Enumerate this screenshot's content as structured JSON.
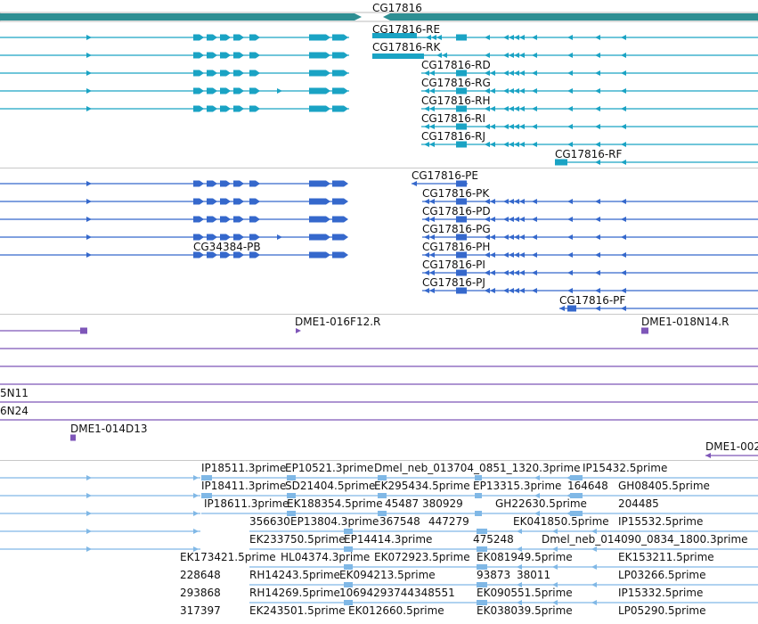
{
  "gene": {
    "name": "CG17816",
    "color": "#2e8f93"
  },
  "colors": {
    "transcript": "#1aa3c4",
    "protein": "#3568cc",
    "clone": "#7e56b8",
    "est": "#80b8e6"
  },
  "transcripts": [
    {
      "name": "CG17816-RE"
    },
    {
      "name": "CG17816-RK"
    },
    {
      "name": "CG17816-RD"
    },
    {
      "name": "CG17816-RG"
    },
    {
      "name": "CG17816-RH"
    },
    {
      "name": "CG17816-RI"
    },
    {
      "name": "CG17816-RJ"
    },
    {
      "name": "CG17816-RF"
    }
  ],
  "proteins": [
    {
      "name": "CG17816-PE"
    },
    {
      "name": "CG17816-PK"
    },
    {
      "name": "CG17816-PD"
    },
    {
      "name": "CG17816-PG"
    },
    {
      "name": "CG17816-PH"
    },
    {
      "name": "CG17816-PI"
    },
    {
      "name": "CG17816-PJ"
    },
    {
      "name": "CG17816-PF"
    },
    {
      "name": "CG34384-PB"
    }
  ],
  "clones": [
    {
      "name": "DME1-016F12.R"
    },
    {
      "name": "DME1-018N14.R"
    },
    {
      "name": "5N11"
    },
    {
      "name": "6N24"
    },
    {
      "name": "DME1-014D13"
    },
    {
      "name": "DME1-002"
    }
  ],
  "ests": [
    "IP18511.3prime",
    "EP10521.3prime",
    "Dmel_neb_013704_0851_1320.3prime",
    "IP15432.5prime",
    "IP18411.3prime",
    "SD21404.5prime",
    "EK295434.5prime",
    "EP13315.3prime",
    "164648",
    "GH08405.5prime",
    "IP18611.3prime",
    "EK188354.5prime",
    "45487",
    "380929",
    "GH22630.5prime",
    "204485",
    "356630",
    "EP13804.3prime",
    "367548",
    "447279",
    "EK041850.5prime",
    "IP15532.5prime",
    "EK233750.5prime",
    "EP14414.3prime",
    "475248",
    "Dmel_neb_014090_0834_1800.3prime",
    "EK173421.5prime",
    "HL04374.3prime",
    "EK072923.5prime",
    "EK081949.5prime",
    "EK153211.5prime",
    "228648",
    "RH14243.5prime",
    "EK094213.5prime",
    "93873",
    "38011",
    "LP03266.5prime",
    "293868",
    "RH14269.5prime",
    "10694293744348551",
    "EK090551.5prime",
    "IP15332.5prime",
    "317397",
    "EK243501.5prime",
    "EK012660.5prime",
    "EK038039.5prime",
    "LP05290.5prime"
  ]
}
